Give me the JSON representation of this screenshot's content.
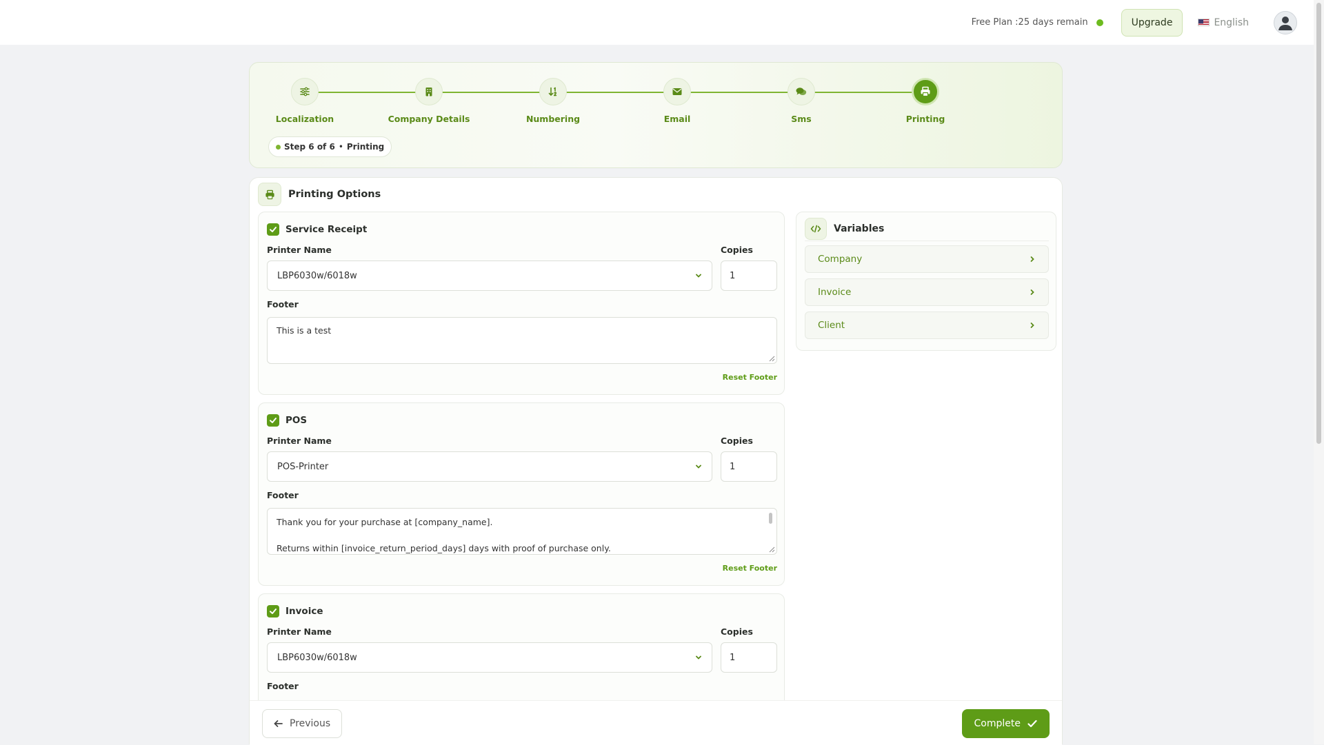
{
  "topbar": {
    "plan_text": "Free Plan :25 days remain",
    "upgrade_label": "Upgrade",
    "language": "English"
  },
  "stepper": {
    "steps": [
      {
        "label": "Localization",
        "icon": "sliders-icon"
      },
      {
        "label": "Company Details",
        "icon": "building-icon"
      },
      {
        "label": "Numbering",
        "icon": "sort-numeric-icon"
      },
      {
        "label": "Email",
        "icon": "envelope-icon"
      },
      {
        "label": "Sms",
        "icon": "chat-bubbles-icon"
      },
      {
        "label": "Printing",
        "icon": "printer-icon"
      }
    ],
    "active_index": 5,
    "pill_step": "Step 6 of 6",
    "pill_sep": "•",
    "pill_name": "Printing"
  },
  "printing": {
    "title": "Printing Options",
    "printer_label": "Printer Name",
    "copies_label": "Copies",
    "footer_label": "Footer",
    "reset_label": "Reset Footer",
    "sections": [
      {
        "title": "Service Receipt",
        "checked": true,
        "printer": "LBP6030w/6018w",
        "copies": "1",
        "footer_line1": "This is a test",
        "footer_line2": ""
      },
      {
        "title": "POS",
        "checked": true,
        "printer": "POS-Printer",
        "copies": "1",
        "footer_line1": "Thank you for your purchase at [company_name].",
        "footer_line2": "Returns within [invoice_return_period_days] days with proof of purchase only."
      },
      {
        "title": "Invoice",
        "checked": true,
        "printer": "LBP6030w/6018w",
        "copies": "1"
      }
    ]
  },
  "variables": {
    "title": "Variables",
    "items": [
      "Company",
      "Invoice",
      "Client"
    ]
  },
  "actions": {
    "previous_label": "Previous",
    "complete_label": "Complete"
  },
  "colors": {
    "accent": "#5e9c17",
    "accent_text": "#5a8a18",
    "status_dot": "#6dbb1f"
  }
}
